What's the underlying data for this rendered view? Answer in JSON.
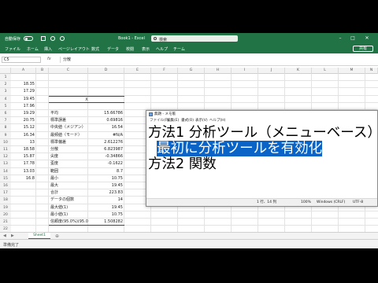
{
  "titlebar": {
    "autosave": "自動保存",
    "document": "Book1 - Excel",
    "search_placeholder": "検索"
  },
  "menu": [
    "ファイル",
    "ホーム",
    "挿入",
    "ページレイアウト",
    "数式",
    "データ",
    "校閲",
    "表示",
    "ヘルプ",
    "チーム"
  ],
  "share_label": "共有",
  "formula_bar": {
    "name_box": "C5",
    "fx": "fx",
    "formula": "分散"
  },
  "columns": [
    "A",
    "B",
    "C",
    "D",
    "E",
    "F",
    "G",
    "H",
    "I",
    "J",
    "K",
    "L",
    "M",
    "N",
    "O",
    "P"
  ],
  "rows": [
    "1",
    "2",
    "3",
    "4",
    "5",
    "6",
    "7",
    "8",
    "9",
    "10",
    "11",
    "12",
    "13",
    "14",
    "15",
    "16",
    "17",
    "18",
    "19",
    "20",
    "21",
    "22",
    "23"
  ],
  "col_a_values": [
    "18.35",
    "17.29",
    "19.45",
    "17.96",
    "19.29",
    "20.75",
    "15.12",
    "16.34",
    "13",
    "18.58",
    "15.87",
    "17.78",
    "13.03",
    "16.8"
  ],
  "stats_header": "X",
  "stats": [
    {
      "label": "平均",
      "value": "15.66786"
    },
    {
      "label": "標準誤差",
      "value": "0.69816"
    },
    {
      "label": "中央値（メジアン）",
      "value": "16.54"
    },
    {
      "label": "最頻値（モード）",
      "value": "#N/A"
    },
    {
      "label": "標準偏差",
      "value": "2.612276"
    },
    {
      "label": "分散",
      "value": "6.823987"
    },
    {
      "label": "尖度",
      "value": "-0.34866"
    },
    {
      "label": "歪度",
      "value": "-0.1622"
    },
    {
      "label": "範囲",
      "value": "8.7"
    },
    {
      "label": "最小",
      "value": "10.75"
    },
    {
      "label": "最大",
      "value": "19.45"
    },
    {
      "label": "合計",
      "value": "223.83"
    },
    {
      "label": "データの個数",
      "value": "14"
    },
    {
      "label": "最大値(1)",
      "value": "19.45"
    },
    {
      "label": "最小値(1)",
      "value": "10.75"
    },
    {
      "label": "信頼度(95.0%)(95.0%)",
      "value": "1.508282"
    }
  ],
  "sheet_tab": "Sheet1",
  "status": "準備完了",
  "notepad": {
    "title": "無題 - メモ帳",
    "menu": [
      "ファイル(F)",
      "編集(E)",
      "書式(O)",
      "表示(V)",
      "ヘルプ(H)"
    ],
    "line1": "方法1 分析ツール（メニューベース）",
    "line2_indent": "  ",
    "line2_selected": "最初に分析ツールを有効化",
    "line3": "方法2 関数",
    "status_pos": "1 行、14 列",
    "status_zoom": "100%",
    "status_eol": "Windows (CRLF)",
    "status_enc": "UTF-8"
  }
}
